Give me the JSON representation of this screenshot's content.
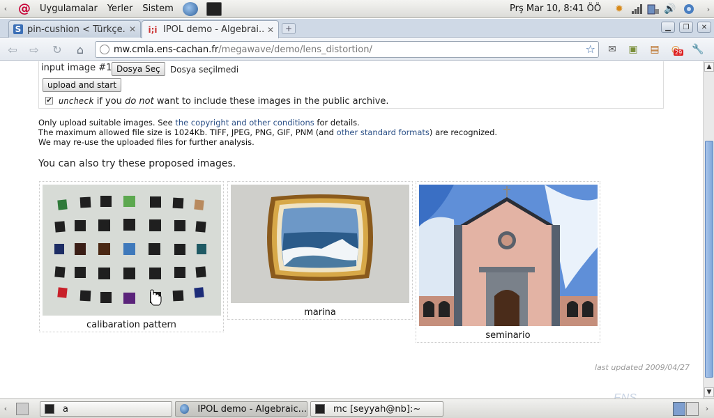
{
  "panel": {
    "menus": [
      "Uygulamalar",
      "Yerler",
      "Sistem"
    ],
    "clock": "Prş Mar 10,  8:41 ÖÖ",
    "calendar_badge": "29"
  },
  "tabs": [
    {
      "favicon": "S",
      "label": "pin-cushion < Türkçe..."
    },
    {
      "favicon": "i;i",
      "label": "IPOL demo - Algebrai..."
    }
  ],
  "address": {
    "host": "mw.cmla.ens-cachan.fr",
    "path": "/megawave/demo/lens_distortion/"
  },
  "upload": {
    "input_label": "input image #1",
    "choose_button": "Dosya Seç",
    "no_file": "Dosya seçilmedi",
    "start_button": "upload and start",
    "uncheck": "uncheck",
    "check_text_1": "if you",
    "do_not": "do not",
    "check_text_2": "want to include these images in the public archive."
  },
  "notes": {
    "line1_a": "Only upload suitable images. See",
    "line1_link": "the copyright and other conditions",
    "line1_b": "for details.",
    "line2_a": "The maximum allowed file size is 1024Kb. TIFF, JPEG, PNG, GIF, PNM (and",
    "line2_link": "other standard formats",
    "line2_b": ") are recognized.",
    "line3": "We may re-use the uploaded files for further analysis."
  },
  "proposed_heading": "You can also try these proposed images.",
  "thumbnails": [
    {
      "caption": "calibaration pattern"
    },
    {
      "caption": "marina"
    },
    {
      "caption": "seminario"
    }
  ],
  "last_updated": "last updated 2009/04/27",
  "taskbar": [
    {
      "label": "a"
    },
    {
      "label": "IPOL demo - Algebraic..."
    },
    {
      "label": "mc [seyyah@nb]:~"
    }
  ],
  "icons": [
    "debian-icon",
    "browser-icon",
    "terminal-icon",
    "star-icon",
    "wrench-icon",
    "cursor-hand-icon"
  ]
}
